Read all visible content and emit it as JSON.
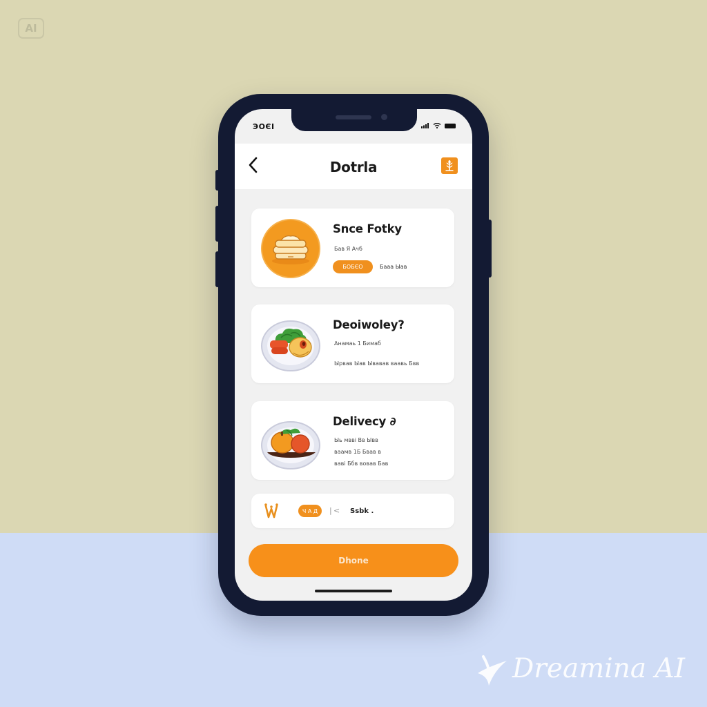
{
  "badge": {
    "label": "AI"
  },
  "watermark": {
    "text": "Dreamina AI"
  },
  "status_bar": {
    "time": "ЭОЄІ"
  },
  "header": {
    "title": "Dotrla",
    "back_icon": "chevron-left-icon",
    "action_icon": "wheat-icon"
  },
  "cards": [
    {
      "title": "Snce Fotky",
      "subtitle": "Бав Я Ачб",
      "pill_label": "БОБЄО",
      "pill_meta": "Бааа Ыав",
      "image": "pancakes-icon"
    },
    {
      "title": "Deoiwoley?",
      "lines": [
        "Анамаь 1 Бимаб",
        "Ырвав Ыав Ывавав ваавь Бвв"
      ],
      "image": "salad-plate-icon"
    },
    {
      "title": "Delivecy ∂",
      "lines": [
        "Ыь мвві Вв Ывв",
        "ваамв 1Б Бвав в",
        "ваві Ббв вовав Бав"
      ],
      "image": "stew-plate-icon"
    }
  ],
  "summary_row": {
    "icon": "wheat-sprout-icon",
    "toggle_label": "Ч А Д",
    "divider_glyph": "|",
    "chevron_glyph": "<",
    "label": "Ssbk ."
  },
  "cta": {
    "label": "Dhone"
  },
  "colors": {
    "accent": "#f0901e",
    "backdrop_top": "#dbd7b3",
    "backdrop_bottom": "#cfdcf6",
    "phone_frame": "#131a33"
  }
}
